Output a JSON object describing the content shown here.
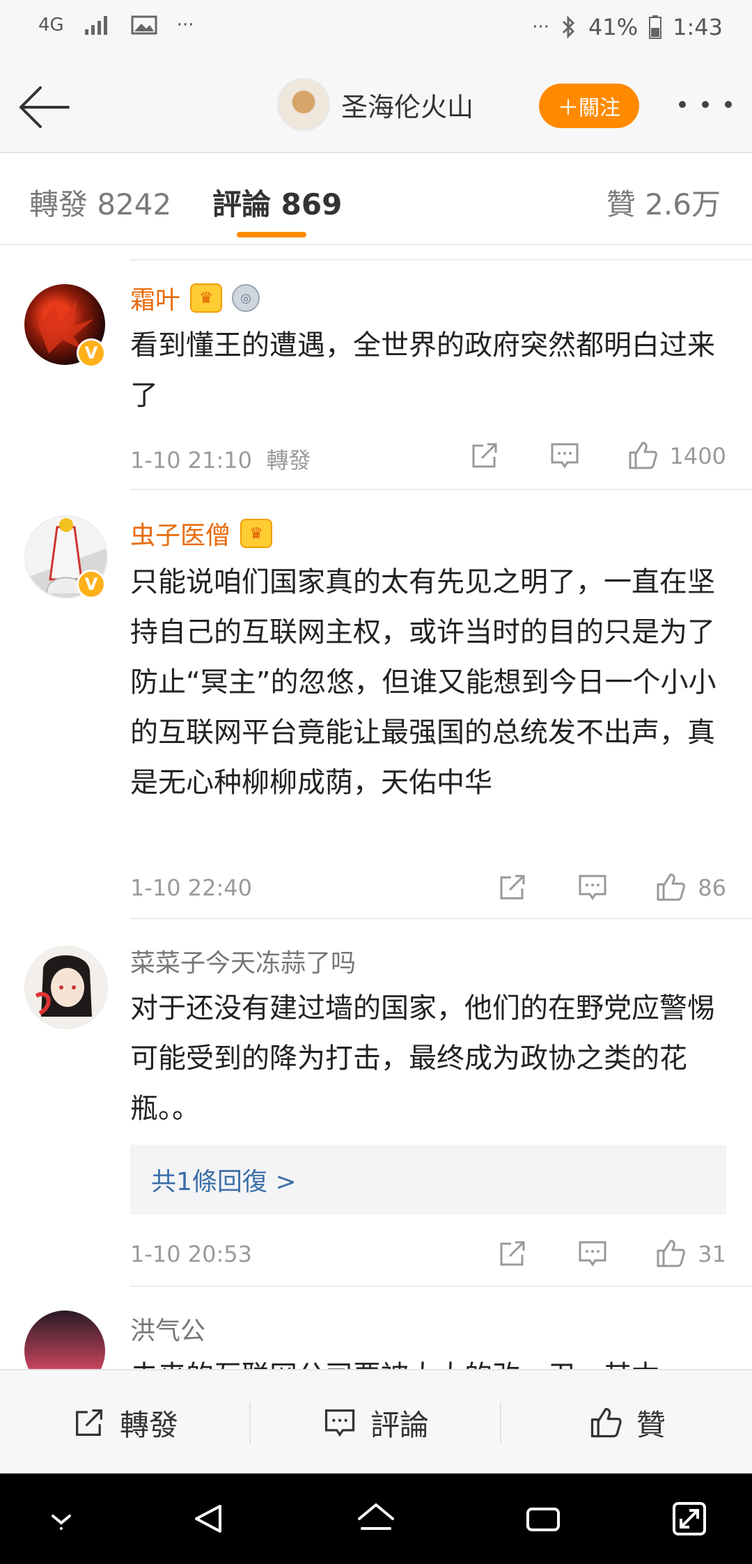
{
  "status_bar": {
    "network": "4G",
    "more": "···",
    "more_right": "···",
    "battery": "41%",
    "time": "1:43"
  },
  "nav": {
    "title": "圣海伦火山",
    "follow_label": "＋關注"
  },
  "tabs": {
    "repost": "轉發 8242",
    "comments": "評論 869",
    "likes": "贊 2.6万"
  },
  "comments": [
    {
      "name": "霜叶",
      "text": "看到懂王的遭遇，全世界的政府突然都明白过来了",
      "time": "1-10 21:10",
      "repost_label": "轉發",
      "likes": "1400"
    },
    {
      "name": "虫子医僧",
      "text": "只能说咱们国家真的太有先见之明了，一直在坚持自己的互联网主权，或许当时的目的只是为了防止“冥主”的忽悠，但谁又能想到今日一个小小的互联网平台竟能让最强国的总统发不出声，真是无心种柳柳成荫，天佑中华",
      "time": "1-10 22:40",
      "likes": "86"
    },
    {
      "name": "菜菜子今天冻蒜了吗",
      "text": "对于还没有建过墙的国家，他们的在野党应警惕可能受到的降为打击，最终成为政协之类的花瓶。。",
      "reply_label": "共1條回復 >",
      "time": "1-10 20:53",
      "likes": "31"
    },
    {
      "name": "洪气公",
      "text": "未来的互联网公司要被大大的改，卫，其本"
    }
  ],
  "bottom_bar": {
    "repost": "轉發",
    "comment": "評論",
    "like": "贊"
  },
  "colors": {
    "accent": "#ff8a00",
    "vip_name": "#e86b0b",
    "link": "#3d6fa8"
  }
}
